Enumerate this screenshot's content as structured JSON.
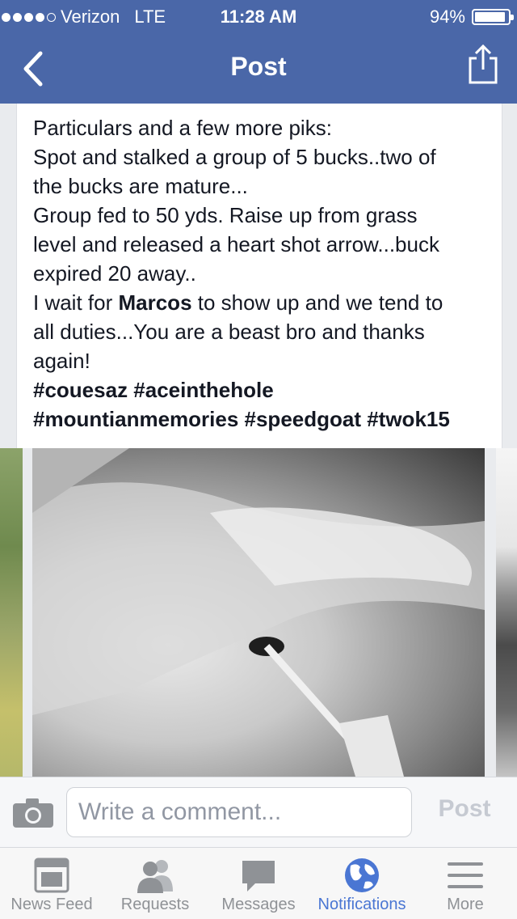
{
  "status_bar": {
    "carrier": "Verizon",
    "network": "LTE",
    "time": "11:28 AM",
    "battery_percent_text": "94%",
    "battery_level": 0.94,
    "signal_bars_filled": 4,
    "signal_bars_total": 5
  },
  "nav": {
    "title": "Post",
    "back_icon": "chevron-left-icon",
    "share_icon": "share-icon"
  },
  "post": {
    "line_1": "Particulars and a few more piks:",
    "line_2": "Spot and stalked a group of 5 bucks..two of",
    "line_3": "the bucks are mature...",
    "line_4": "Group fed to 50 yds. Raise up from grass",
    "line_5": "level and released a heart shot arrow...buck",
    "line_6": "expired 20 away..",
    "line_7_before": "I wait for ",
    "line_7_mention": "Marcos",
    "line_7_after": " to show up and we tend to",
    "line_8": "all duties...You are a beast bro and thanks",
    "line_9": "again!",
    "hashtags_line_1": "#couesaz #aceinthehole",
    "hashtags_line_2": "#mountianmemories #speedgoat #twok15"
  },
  "comment_bar": {
    "camera_icon": "camera-icon",
    "placeholder": "Write a comment...",
    "post_label": "Post"
  },
  "tabs": [
    {
      "label": "News Feed",
      "icon": "news-feed-icon",
      "active": false
    },
    {
      "label": "Requests",
      "icon": "friend-requests-icon",
      "active": false
    },
    {
      "label": "Messages",
      "icon": "messages-icon",
      "active": false
    },
    {
      "label": "Notifications",
      "icon": "globe-icon",
      "active": true
    },
    {
      "label": "More",
      "icon": "menu-icon",
      "active": false
    }
  ],
  "colors": {
    "brand": "#4a67a8",
    "active_tab": "#4a76d3",
    "inactive_tab": "#8f9296"
  }
}
